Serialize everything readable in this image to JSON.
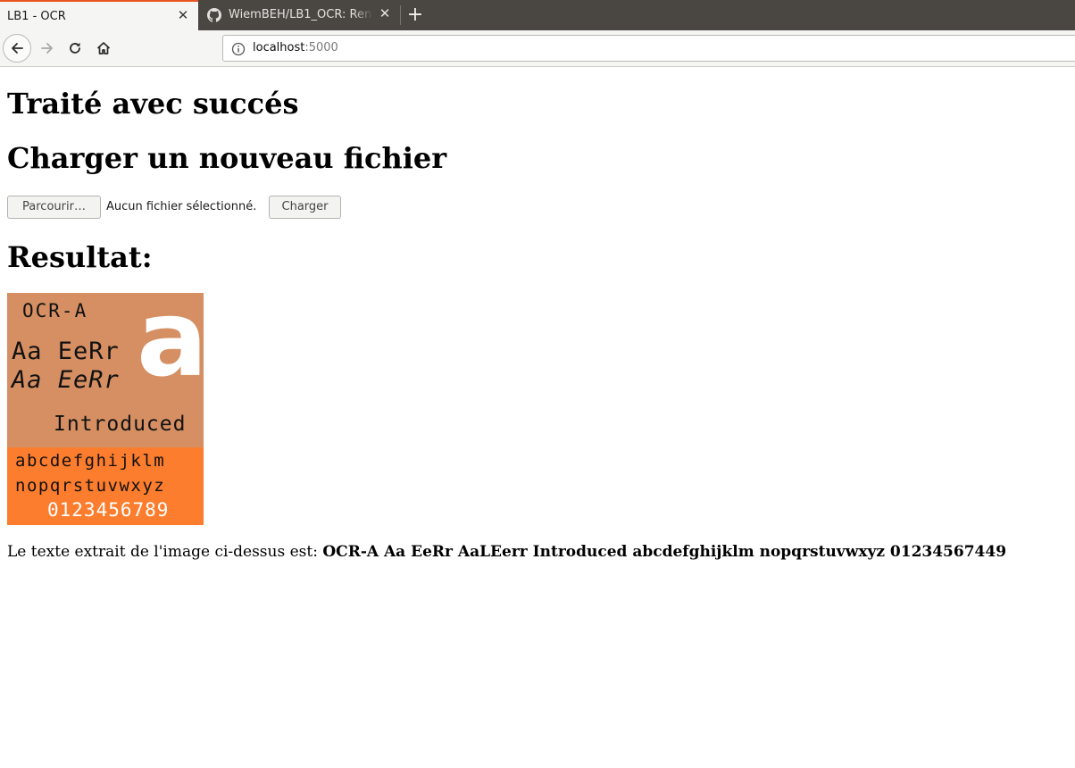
{
  "browser": {
    "tabs": [
      {
        "title": "LB1 - OCR",
        "active": true
      },
      {
        "title": "WiemBEH/LB1_OCR: Ren",
        "active": false
      }
    ],
    "close_glyph": "✕",
    "new_tab_glyph": "+",
    "url": {
      "host": "localhost",
      "port": ":5000"
    }
  },
  "page": {
    "heading_success": "Traité avec succés",
    "heading_upload": "Charger un nouveau fichier",
    "browse_button": "Parcourir…",
    "no_file": "Aucun fichier sélectionné.",
    "submit_button": "Charger",
    "heading_result": "Resultat:",
    "ocr_image": {
      "name": "OCR-A",
      "sample_upright": "Aa EeRr",
      "sample_italic": "Aa EeRr",
      "big_letter": "a",
      "introduced": "Introduced",
      "lower_1": "abcdefghijklm",
      "lower_2": "nopqrstuvwxyz",
      "digits": "0123456789",
      "colors": {
        "top": "#d58f62",
        "bottom": "#fc7d2e"
      }
    },
    "result_prefix": "Le texte extrait de l'image ci-dessus est: ",
    "result_text": "OCR-A Aa EeRr AaLEerr Introduced abcdefghijklm nopqrstuvwxyz 01234567449"
  },
  "colors": {
    "tab_accent": "#e95420",
    "tabstrip": "#4a4742"
  }
}
